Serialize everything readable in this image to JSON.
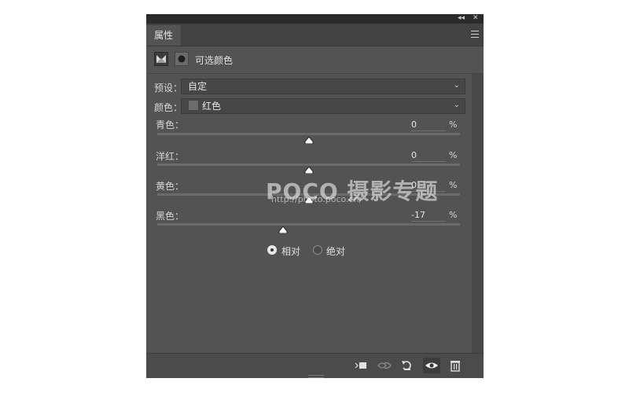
{
  "panel": {
    "tab_label": "属性",
    "title": "可选颜色",
    "collapse_glyph": "◂◂",
    "close_glyph": "✕"
  },
  "preset": {
    "label": "预设：",
    "value": "自定"
  },
  "colors": {
    "label": "颜色：",
    "value": "红色"
  },
  "sliders": [
    {
      "label": "青色：",
      "value": "0",
      "unit": "%",
      "level": 0
    },
    {
      "label": "洋红：",
      "value": "0",
      "unit": "%",
      "level": 0
    },
    {
      "label": "黄色：",
      "value": "0",
      "unit": "%",
      "level": 0
    },
    {
      "label": "黑色：",
      "value": "-17",
      "unit": "%",
      "level": -17
    }
  ],
  "method": {
    "relative": "相对",
    "absolute": "绝对",
    "selected": "relative"
  },
  "icons": [
    "clip-to-layer-icon",
    "view-previous-icon",
    "reset-icon",
    "visibility-eye-icon",
    "trash-icon"
  ],
  "watermark": {
    "brand": "POCO 摄影专题",
    "url": "http://photo.poco.cn/"
  }
}
